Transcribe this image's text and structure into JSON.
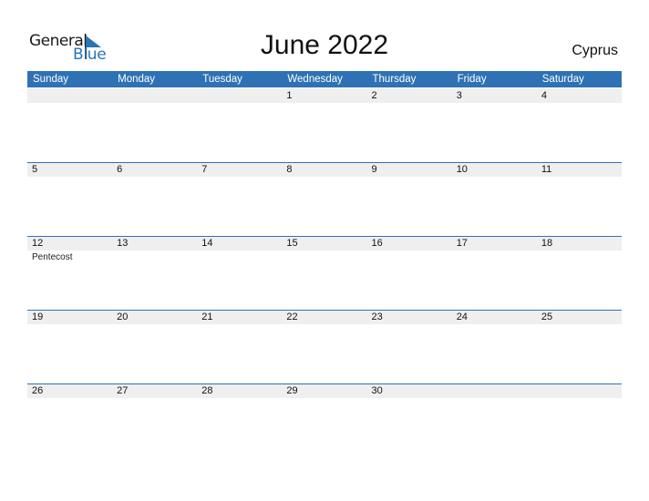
{
  "logo": {
    "line1": "General",
    "line2": "Blue"
  },
  "title": "June 2022",
  "country": "Cyprus",
  "colors": {
    "accent": "#2e72b5",
    "band": "#efefef"
  },
  "weekdays": [
    "Sunday",
    "Monday",
    "Tuesday",
    "Wednesday",
    "Thursday",
    "Friday",
    "Saturday"
  ],
  "weeks": [
    [
      "",
      "",
      "",
      "1",
      "2",
      "3",
      "4"
    ],
    [
      "5",
      "6",
      "7",
      "8",
      "9",
      "10",
      "11"
    ],
    [
      "12",
      "13",
      "14",
      "15",
      "16",
      "17",
      "18"
    ],
    [
      "19",
      "20",
      "21",
      "22",
      "23",
      "24",
      "25"
    ],
    [
      "26",
      "27",
      "28",
      "29",
      "30",
      "",
      ""
    ]
  ],
  "events": [
    {
      "week": 2,
      "day": 0,
      "label": "Pentecost"
    }
  ]
}
